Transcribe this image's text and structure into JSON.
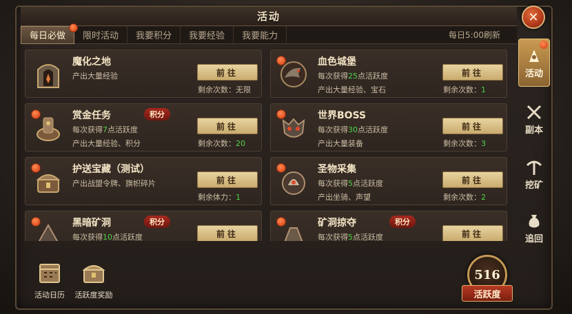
{
  "header": {
    "title": "活动",
    "close_label": "✕",
    "refresh_text": "每日5:00刷新"
  },
  "tabs": [
    {
      "label": "每日必做",
      "active": true
    },
    {
      "label": "限时活动"
    },
    {
      "label": "我要积分"
    },
    {
      "label": "我要经验"
    },
    {
      "label": "我要能力"
    }
  ],
  "cards": [
    {
      "name": "魔化之地",
      "line1": "产出大量经验",
      "line2": "",
      "button": "前往",
      "remain_label": "剩余次数：",
      "remain_value": "无限",
      "badge": ""
    },
    {
      "name": "血色城堡",
      "line1_prefix": "每次获得",
      "line1_num": "25",
      "line1_suffix": "点活跃度",
      "line2": "产出大量经验、宝石",
      "button": "前往",
      "remain_label": "剩余次数：",
      "remain_value": "1",
      "badge": ""
    },
    {
      "name": "赏金任务",
      "line1_prefix": "每次获得",
      "line1_num": "7",
      "line1_suffix": "点活跃度",
      "line2": "产出大量经验、积分",
      "button": "前往",
      "remain_label": "剩余次数：",
      "remain_value": "20",
      "badge": "积分"
    },
    {
      "name": "世界BOSS",
      "line1_prefix": "每次获得",
      "line1_num": "30",
      "line1_suffix": "点活跃度",
      "line2": "产出大量装备",
      "button": "前往",
      "remain_label": "剩余次数：",
      "remain_value": "3",
      "badge": ""
    },
    {
      "name": "护送宝藏（测试）",
      "line1": "产出战盟令牌、旗帜碎片",
      "line2": "",
      "button": "前往",
      "remain_label": "剩余体力：",
      "remain_value": "1",
      "badge": ""
    },
    {
      "name": "圣物采集",
      "line1_prefix": "每次获得",
      "line1_num": "5",
      "line1_suffix": "点活跃度",
      "line2": "产出坐骑、声望",
      "button": "前往",
      "remain_label": "剩余次数：",
      "remain_value": "2",
      "badge": ""
    },
    {
      "name": "黑暗矿洞",
      "line1_prefix": "每次获得",
      "line1_num": "10",
      "line1_suffix": "点活跃度",
      "line2": "",
      "button": "前往",
      "remain_label": "",
      "remain_value": "",
      "badge": "积分"
    },
    {
      "name": "矿洞掠夺",
      "line1_prefix": "每次获得",
      "line1_num": "5",
      "line1_suffix": "点活跃度",
      "line2": "",
      "button": "前往",
      "remain_label": "",
      "remain_value": "",
      "badge": "积分"
    }
  ],
  "sidebar": [
    {
      "label": "活动",
      "icon": "activity-icon",
      "active": true
    },
    {
      "label": "副本",
      "icon": "crossed-swords-icon"
    },
    {
      "label": "挖矿",
      "icon": "pickaxe-icon"
    },
    {
      "label": "追回",
      "icon": "money-bag-icon"
    }
  ],
  "bottom": {
    "calendar_label": "活动日历",
    "reward_label": "活跃度奖励"
  },
  "activity": {
    "value": "516",
    "label": "活跃度"
  },
  "colors": {
    "accent_green": "#4fd34a",
    "badge_red": "#a6281d",
    "button_gold": "#d9bf85"
  }
}
